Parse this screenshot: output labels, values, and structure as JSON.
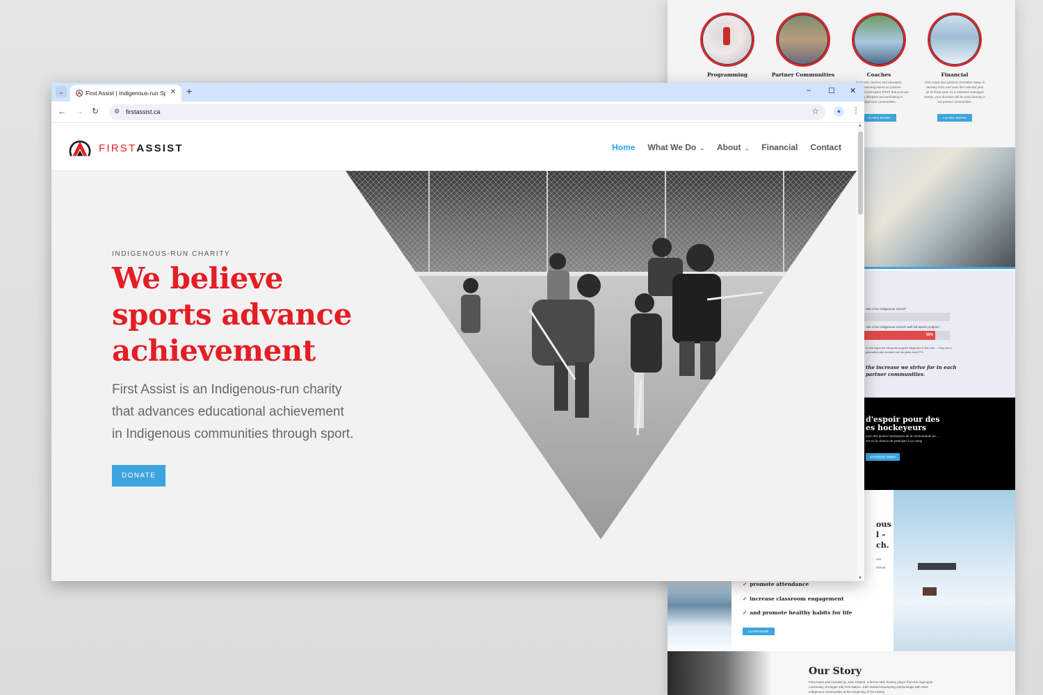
{
  "browser": {
    "tab_title": "First Assist | Indigenous-run Sp",
    "url": "firstassist.ca",
    "new_tab": "+",
    "controls": {
      "minimize": "–",
      "maximize": "☐",
      "close": "✕"
    }
  },
  "site": {
    "brand_first": "FIRST",
    "brand_second": "ASSIST",
    "nav": {
      "home": "Home",
      "what_we_do": "What We Do",
      "about": "About",
      "financial": "Financial",
      "contact": "Contact"
    },
    "hero": {
      "eyebrow": "INDIGENOUS-RUN CHARITY",
      "headline_line1": "We believe",
      "headline_line2": "sports advance",
      "headline_line3": "achievement",
      "lede": "First Assist is an Indigenous-run charity that advances educational achievement in Indigenous communities through sport.",
      "donate": "DONATE"
    }
  },
  "background_page": {
    "cards": [
      {
        "title": "Programming",
        "text": "",
        "button": ""
      },
      {
        "title": "Partner Communities",
        "text": "",
        "button": ""
      },
      {
        "title": "Coaches",
        "text": "Supports coaches and educators programming based on positive development principles (PEP) that promote healthy lifestyles and well-being in Indigenous communities.",
        "button": "LEARN MORE"
      },
      {
        "title": "Financial",
        "text": "First Assist was granted charitable status in January 2021 and uses the calendar year as its fiscal year. As a volunteer-managed charity, your donation will be used directly in our partner communities.",
        "button": "LEARN MORE"
      }
    ],
    "stats": {
      "line1": "rate of an Indigenous school*",
      "line2": "rate of an Indigenous school* with full sports program",
      "percent": "85%",
      "note": "is referring to the full sports program integration in the Cree ... They had a graduation rate increase over six years from 57%",
      "tagline_1": "the increase we strive for in each",
      "tagline_2": "partner communities."
    },
    "black_band": {
      "title_1": "d'espoir pour des",
      "title_2": "es hockeyeurs",
      "text": "pour des jeunes hockeyeurs de la communauté de ... ont eu la chance de participer à un camp",
      "button": "STAGRAM VIDEO"
    },
    "partial_heading": [
      "ous",
      "l –",
      "ch."
    ],
    "partial_text": [
      "ose",
      "ational"
    ],
    "checks": [
      "promote attendance",
      "increase classroom engagement",
      "and promote healthy habits for life"
    ],
    "checks_button": "LEARN MORE",
    "story_title": "Our Story",
    "story_text": "First Assist was founded by John Chabot, a former NHL hockey player from the Algonquin community of Kitigan Zibi First Nation. John started developing relationships with other Indigenous communities at the beginning of his hockey"
  },
  "colors": {
    "brand_red": "#e31e24",
    "accent_blue": "#3da5dd",
    "nav_active": "#2ea3f2",
    "tabstrip": "#d3e3fd"
  },
  "icons": {
    "tab_search": "chevron-down-icon",
    "back": "arrow-left-icon",
    "forward": "arrow-right-icon",
    "reload": "reload-icon",
    "site_info": "tune-icon",
    "bookmark": "star-icon",
    "profile": "profile-icon",
    "menu": "kebab-icon"
  }
}
